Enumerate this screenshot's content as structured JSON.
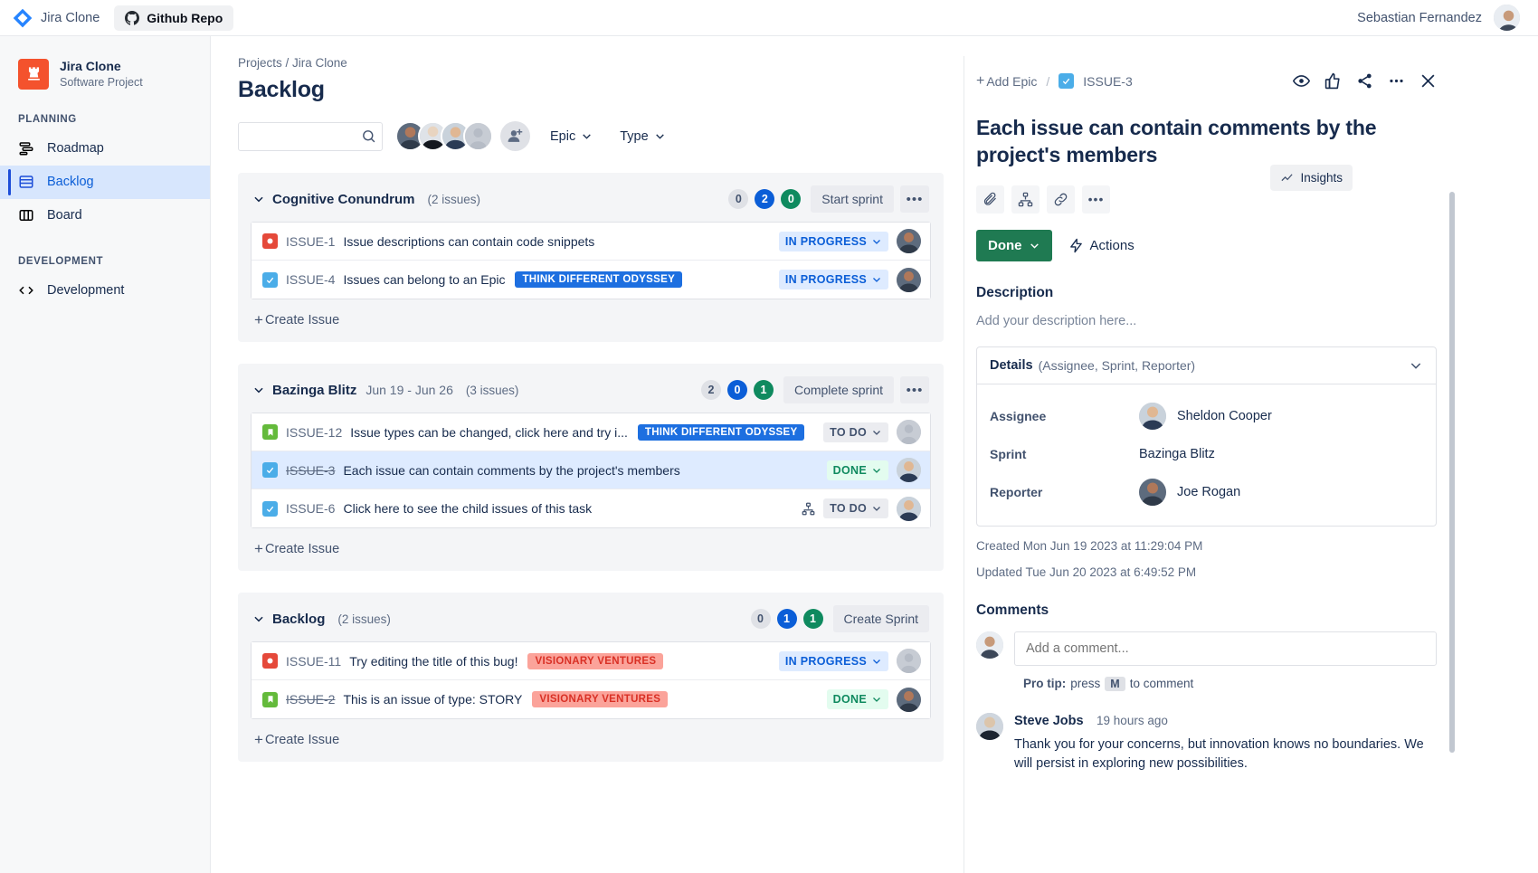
{
  "topbar": {
    "brand": "Jira Clone",
    "github_button": "Github Repo",
    "user_name": "Sebastian Fernandez"
  },
  "sidebar": {
    "project_name": "Jira Clone",
    "project_type": "Software Project",
    "sections": [
      {
        "label": "PLANNING",
        "items": [
          {
            "label": "Roadmap",
            "icon": "roadmap-icon",
            "active": false
          },
          {
            "label": "Backlog",
            "icon": "backlog-icon",
            "active": true
          },
          {
            "label": "Board",
            "icon": "board-icon",
            "active": false
          }
        ]
      },
      {
        "label": "DEVELOPMENT",
        "items": [
          {
            "label": "Development",
            "icon": "code-icon",
            "active": false
          }
        ]
      }
    ]
  },
  "main": {
    "breadcrumb": "Projects / Jira Clone",
    "page_title": "Backlog",
    "search_placeholder": "",
    "search_value": "",
    "epic_filter": "Epic",
    "type_filter": "Type",
    "insights_button": "Insights",
    "create_issue_label": "Create Issue",
    "groups": [
      {
        "name": "Cognitive Conundrum",
        "dates": "",
        "count": "(2 issues)",
        "pills": [
          "0",
          "2",
          "0"
        ],
        "action": "Start sprint",
        "issues": [
          {
            "type": "bug",
            "key": "ISSUE-1",
            "key_done": false,
            "title": "Issue descriptions can contain code snippets",
            "epic": "",
            "epic_color": "",
            "status": "IN PROGRESS",
            "status_class": "st-inprogress",
            "child_icon": false,
            "avatar": "joe",
            "selected": false
          },
          {
            "type": "task",
            "key": "ISSUE-4",
            "key_done": false,
            "title": "Issues can belong to an Epic",
            "epic": "THINK DIFFERENT ODYSSEY",
            "epic_color": "epic-blue",
            "status": "IN PROGRESS",
            "status_class": "st-inprogress",
            "child_icon": false,
            "avatar": "joe",
            "selected": false
          }
        ]
      },
      {
        "name": "Bazinga Blitz",
        "dates": "Jun 19 - Jun 26",
        "count": "(3 issues)",
        "pills": [
          "2",
          "0",
          "1"
        ],
        "action": "Complete sprint",
        "issues": [
          {
            "type": "story",
            "key": "ISSUE-12",
            "key_done": false,
            "title": "Issue types can be changed, click here and try i...",
            "epic": "THINK DIFFERENT ODYSSEY",
            "epic_color": "epic-blue",
            "status": "TO DO",
            "status_class": "st-todo",
            "child_icon": false,
            "avatar": "none",
            "selected": false
          },
          {
            "type": "task",
            "key": "ISSUE-3",
            "key_done": true,
            "title": "Each issue can contain comments by the project's members",
            "epic": "",
            "epic_color": "",
            "status": "DONE",
            "status_class": "st-done",
            "child_icon": false,
            "avatar": "sheldon",
            "selected": true
          },
          {
            "type": "task",
            "key": "ISSUE-6",
            "key_done": false,
            "title": "Click here to see the child issues of this task",
            "epic": "",
            "epic_color": "",
            "status": "TO DO",
            "status_class": "st-todo",
            "child_icon": true,
            "avatar": "sheldon",
            "selected": false
          }
        ]
      },
      {
        "name": "Backlog",
        "dates": "",
        "count": "(2 issues)",
        "pills": [
          "0",
          "1",
          "1"
        ],
        "action": "Create Sprint",
        "issues": [
          {
            "type": "bug",
            "key": "ISSUE-11",
            "key_done": false,
            "title": "Try editing the title of this bug!",
            "epic": "VISIONARY VENTURES",
            "epic_color": "epic-red",
            "status": "IN PROGRESS",
            "status_class": "st-inprogress",
            "child_icon": false,
            "avatar": "none",
            "selected": false
          },
          {
            "type": "story",
            "key": "ISSUE-2",
            "key_done": true,
            "title": "This is an issue of type: STORY",
            "epic": "VISIONARY VENTURES",
            "epic_color": "epic-red",
            "status": "DONE",
            "status_class": "st-done",
            "child_icon": false,
            "avatar": "joe",
            "selected": false
          }
        ]
      }
    ]
  },
  "detail": {
    "add_epic": "Add Epic",
    "separator": "/",
    "issue_key": "ISSUE-3",
    "title": "Each issue can contain comments by the project's members",
    "status_button": "Done",
    "actions_button": "Actions",
    "description_heading": "Description",
    "description_placeholder": "Add your description here...",
    "details_title": "Details",
    "details_subtitle": "(Assignee, Sprint, Reporter)",
    "fields": [
      {
        "label": "Assignee",
        "value": "Sheldon Cooper",
        "avatar": "sheldon"
      },
      {
        "label": "Sprint",
        "value": "Bazinga Blitz",
        "avatar": "none"
      },
      {
        "label": "Reporter",
        "value": "Joe Rogan",
        "avatar": "joe"
      }
    ],
    "created": "Created Mon Jun 19 2023 at 11:29:04 PM",
    "updated": "Updated Tue Jun 20 2023 at 6:49:52 PM",
    "comments_heading": "Comments",
    "comment_placeholder": "Add a comment...",
    "protip_prefix": "Pro tip:",
    "protip_press": "press",
    "protip_key": "M",
    "protip_suffix": "to comment",
    "comments": [
      {
        "author": "Steve Jobs",
        "time": "19 hours ago",
        "text": "Thank you for your concerns, but innovation knows no boundaries. We will persist in exploring new possibilities."
      }
    ]
  },
  "colors": {
    "accent_blue": "#0b5ed7",
    "done_green": "#1f7a52",
    "bug_red": "#e5493a",
    "story_green": "#64ba3b",
    "task_blue": "#4bade8",
    "epic_blue": "#1d6fe0",
    "epic_red_bg": "#fba39a"
  }
}
